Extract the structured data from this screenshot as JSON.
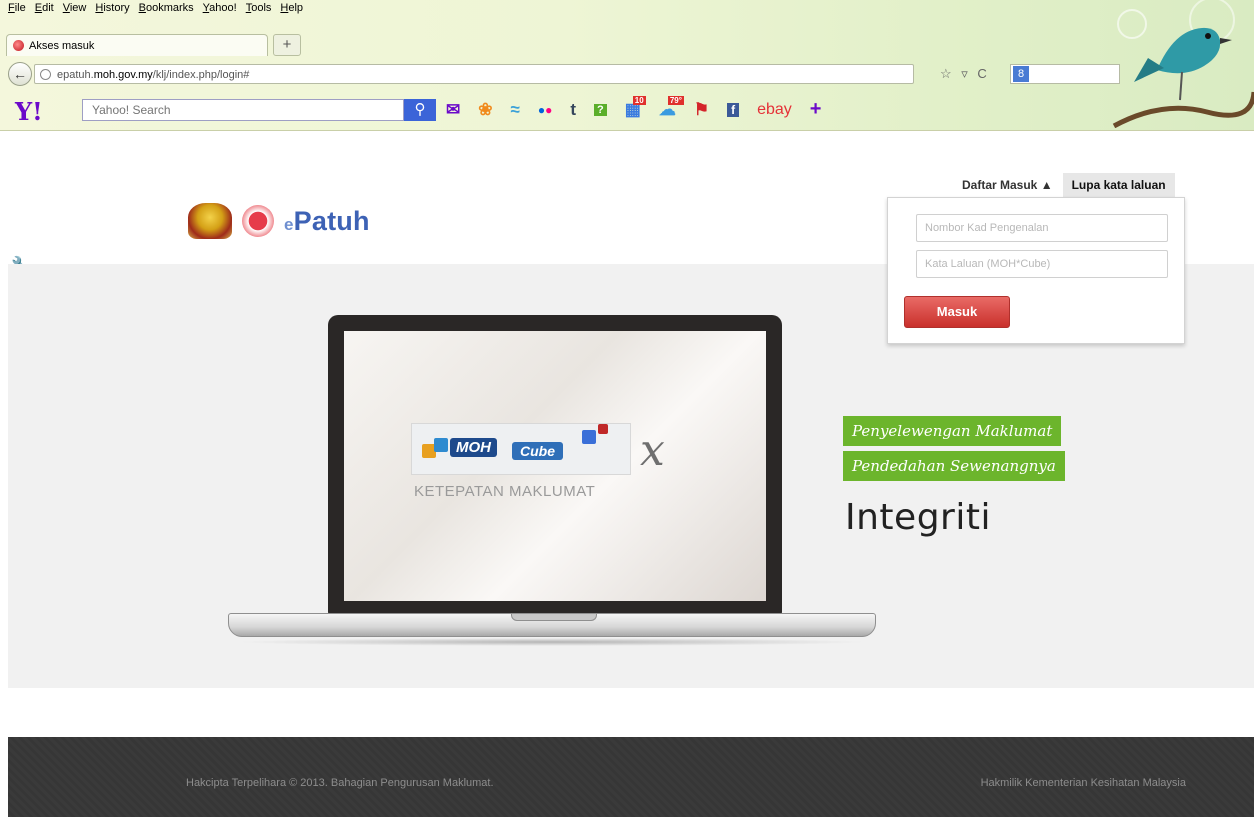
{
  "browser": {
    "menu": [
      "File",
      "Edit",
      "View",
      "History",
      "Bookmarks",
      "Yahoo!",
      "Tools",
      "Help"
    ],
    "tab_title": "Akses masuk",
    "new_tab": "+",
    "url_host_prefix": "epatuh.",
    "url_host_main": "moh.gov.my",
    "url_path": "/klj/index.php/login#",
    "url_tools": "☆ ▿ C",
    "google_label": "8"
  },
  "yahoo_toolbar": {
    "logo": "Y!",
    "search_placeholder": "Yahoo! Search",
    "icons": [
      "mail-icon",
      "sports-icon",
      "finance-icon",
      "flickr-icon",
      "tumblr-icon",
      "answers-icon",
      "news-icon",
      "weather-icon",
      "bookmarks-icon",
      "facebook-icon",
      "ebay-icon",
      "add-icon"
    ],
    "news_badge": "10",
    "weather_badge": "79°",
    "ebay": "ebay",
    "add": "+"
  },
  "page": {
    "brand": "Patuh",
    "brand_prefix": "e",
    "login_tab_active": "Daftar Masuk ▲",
    "login_tab_other": "Lupa kata laluan",
    "ic_placeholder": "Nombor Kad Pengenalan",
    "password_placeholder": "Kata Laluan (MOH*Cube)",
    "submit_label": "Masuk",
    "screen_moh": "MOH",
    "screen_cube": "Cube",
    "screen_x": "x",
    "screen_caption": "KETEPATAN MAKLUMAT",
    "tag1": "Penyelewengan Maklumat",
    "tag2": "Pendedahan Sewenangnya",
    "headline": "Integriti"
  },
  "footer": {
    "left": "Hakcipta Terpelihara © 2013. Bahagian Pengurusan Maklumat.",
    "right": "Hakmilik Kementerian Kesihatan Malaysia"
  },
  "colors": {
    "brand_blue": "#3d62b5",
    "button_red": "#c9302c",
    "tag_green": "#6cb52c",
    "footer_bg": "#3a3a3a",
    "yahoo_purple": "#6b0ac9"
  }
}
